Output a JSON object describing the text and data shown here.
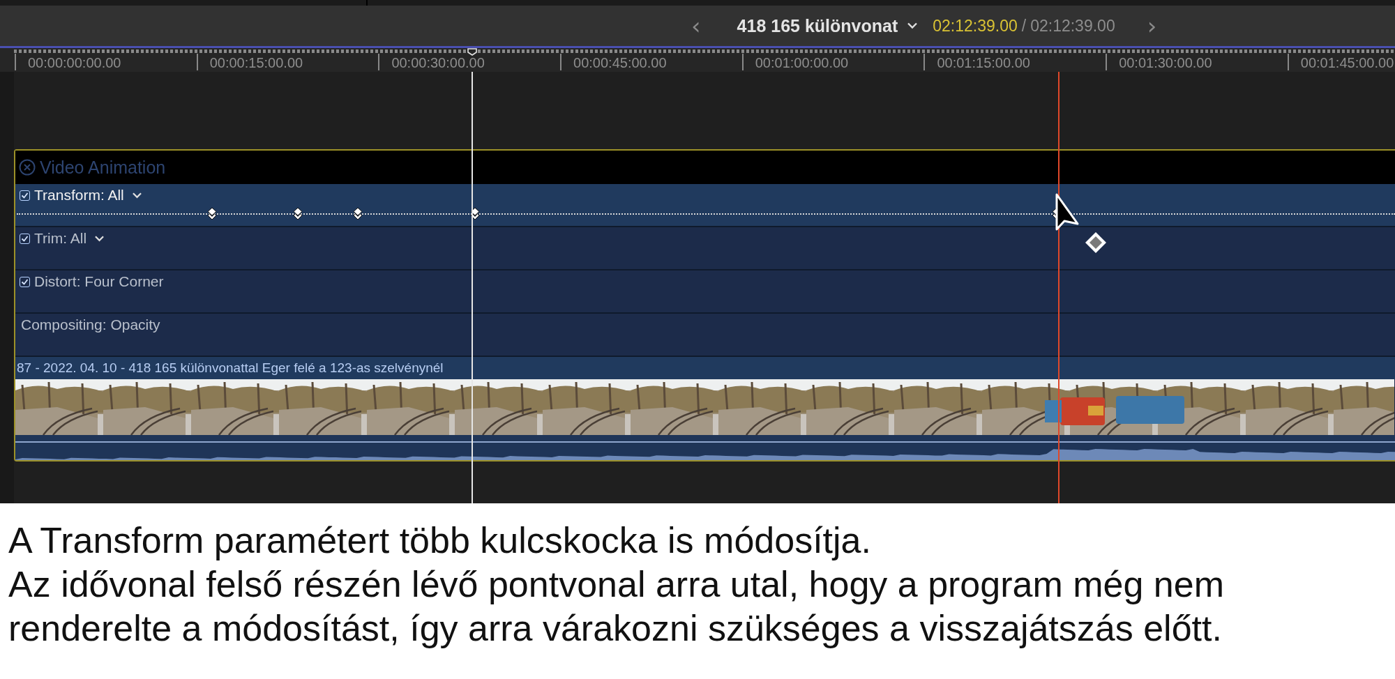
{
  "header": {
    "prev": "‹",
    "title": "418 165 különvonat",
    "timecode_current": "02:12:39.00",
    "separator": "/",
    "timecode_total": "02:12:39.00",
    "next": "›"
  },
  "ruler": {
    "labels": [
      "00:00:00:00.00",
      "00:00:15:00.00",
      "00:00:30:00.00",
      "00:00:45:00.00",
      "00:01:00:00.00",
      "00:01:15:00.00",
      "00:01:30:00.00",
      "00:01:45:00.00"
    ]
  },
  "animation_editor": {
    "title": "Video Animation",
    "rows": [
      {
        "label": "Transform: All",
        "kind": "check",
        "checked": true,
        "menu": true,
        "selected": true
      },
      {
        "label": "Trim: All",
        "kind": "check",
        "checked": true,
        "menu": true,
        "selected": false
      },
      {
        "label": "Distort: Four Corner",
        "kind": "check",
        "checked": true,
        "menu": false,
        "selected": false
      },
      {
        "label": "Compositing: Opacity",
        "kind": "plain",
        "menu": false,
        "selected": false
      }
    ]
  },
  "clip": {
    "title": "87 - 2022. 04. 10 - 418 165 különvonattal Eger felé a 123-as szelvénynél"
  },
  "caption": {
    "paragraphs": [
      "A Transform paramétert több kulcskocka is módosítja.",
      "Az idővonal felső részén lévő pontvonal arra utal, hogy a program még nem renderelte a módosítást, így arra várakozni szükséges a visszajátszás előtt."
    ]
  }
}
